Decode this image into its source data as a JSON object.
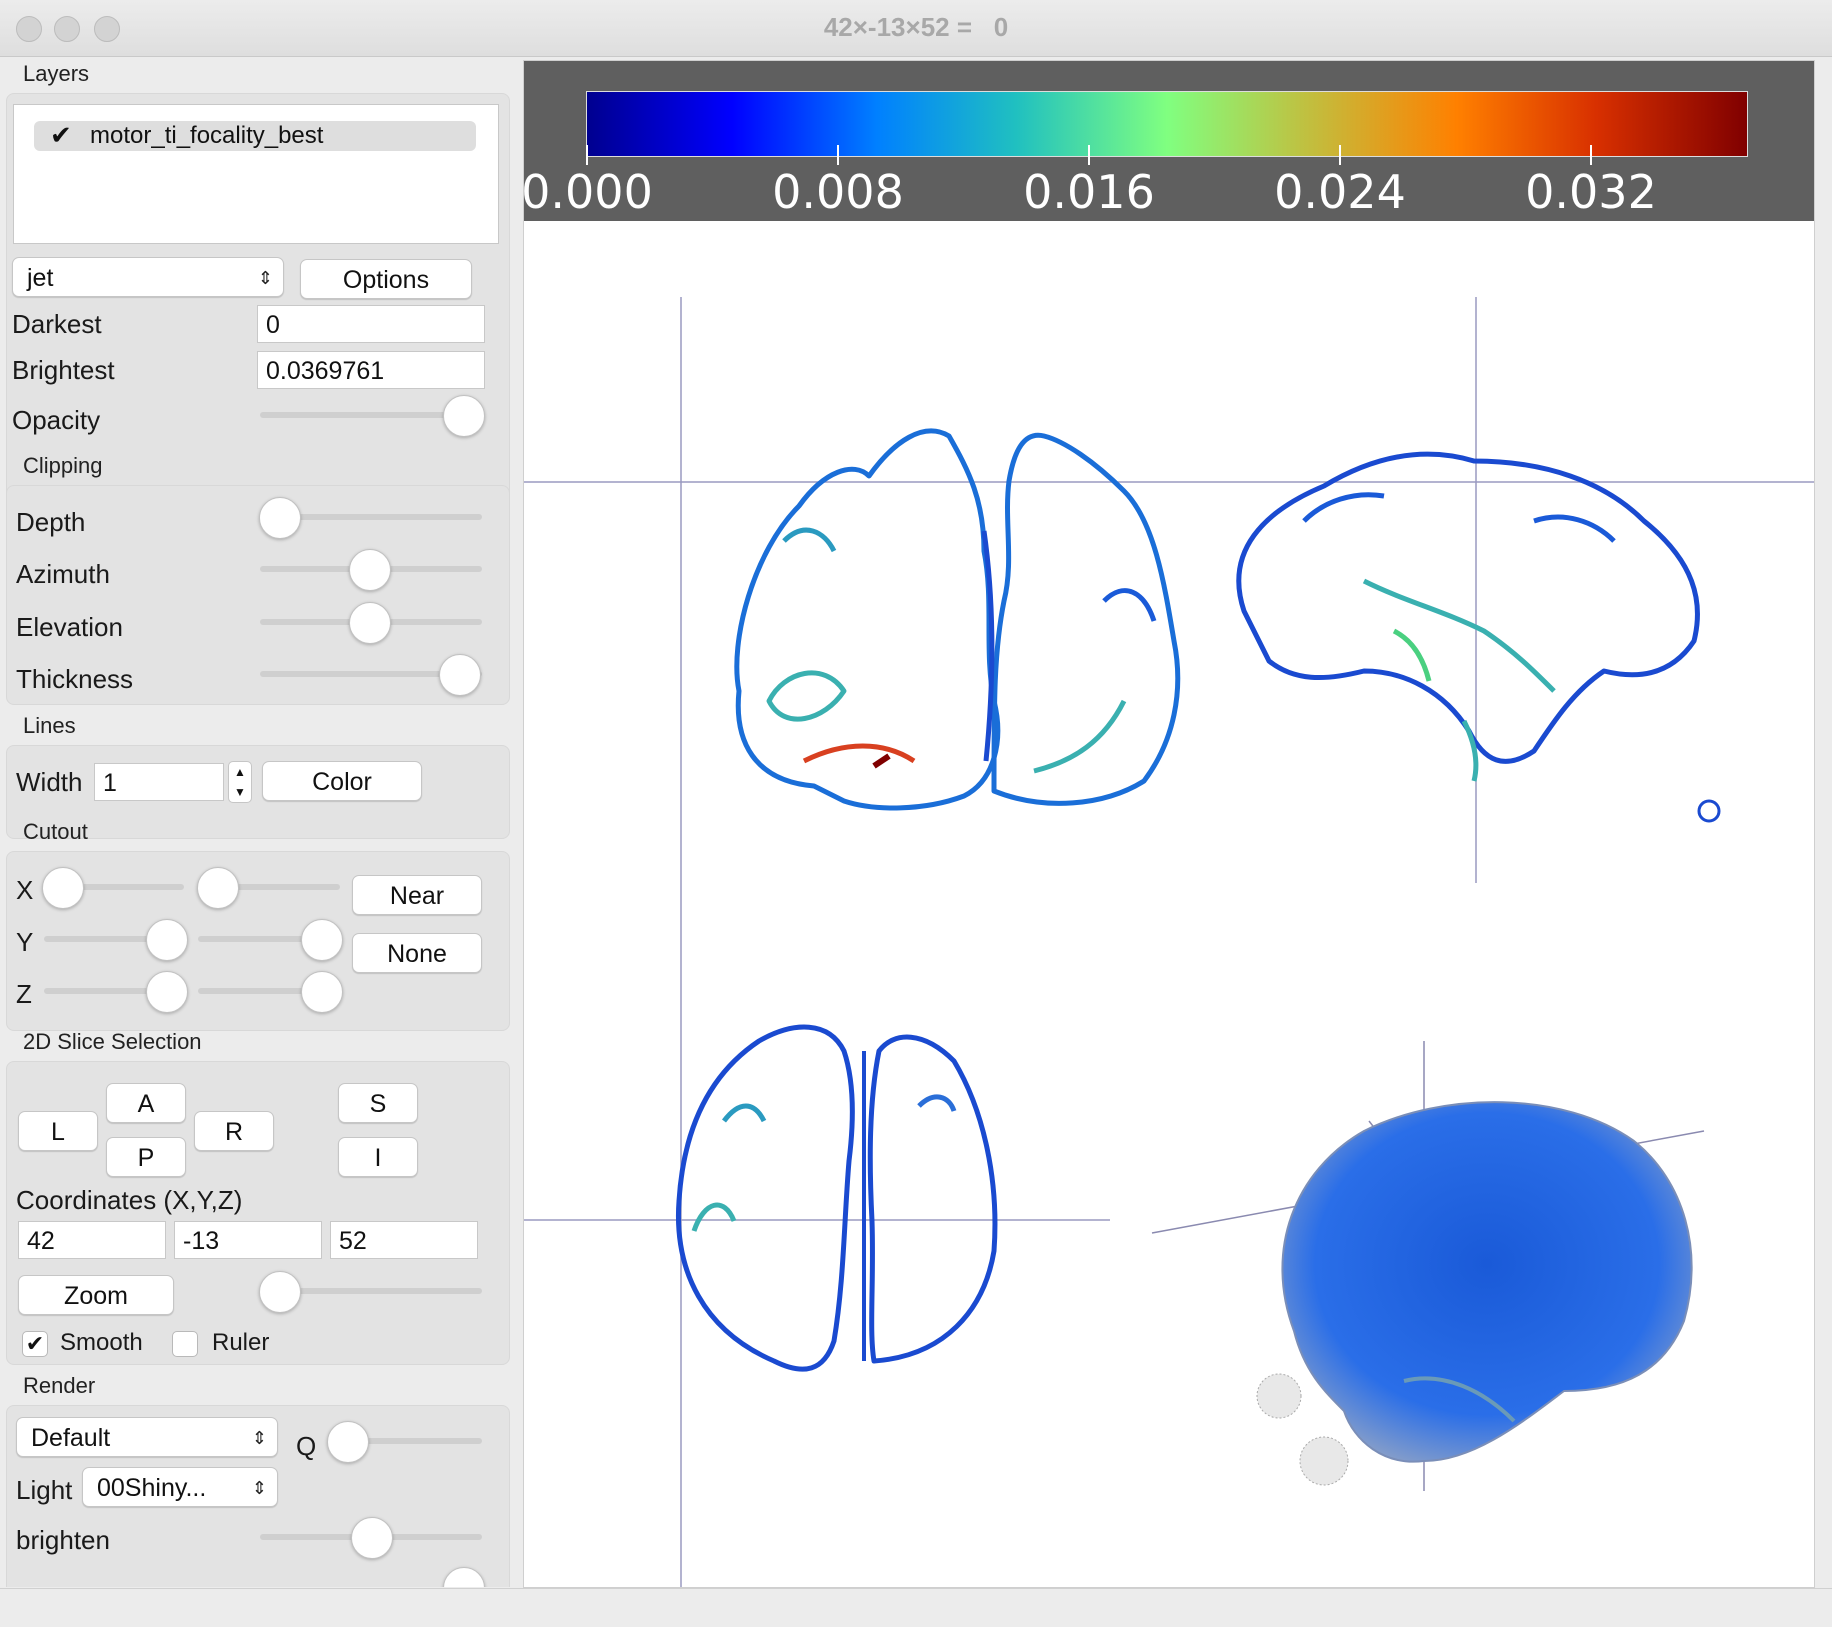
{
  "window": {
    "title": "42×-13×52 =   0"
  },
  "sections": {
    "layers": "Layers",
    "clipping": "Clipping",
    "lines": "Lines",
    "cutout": "Cutout",
    "slice": "2D Slice Selection",
    "render": "Render"
  },
  "layers": {
    "items": [
      {
        "name": "motor_ti_focality_best",
        "checked": true
      }
    ]
  },
  "colormap": {
    "selected": "jet",
    "options_label": "Options"
  },
  "darkest": {
    "label": "Darkest",
    "value": "0"
  },
  "brightest": {
    "label": "Brightest",
    "value": "0.0369761"
  },
  "opacity": {
    "label": "Opacity",
    "level": 1.0
  },
  "clipping": {
    "depth": {
      "label": "Depth",
      "level": 0.0
    },
    "azimuth": {
      "label": "Azimuth",
      "level": 0.5
    },
    "elevation": {
      "label": "Elevation",
      "level": 0.5
    },
    "thickness": {
      "label": "Thickness",
      "level": 1.0
    }
  },
  "lines": {
    "width_label": "Width",
    "width_value": "1",
    "color_label": "Color"
  },
  "cutout": {
    "x_label": "X",
    "y_label": "Y",
    "z_label": "Z",
    "near_label": "Near",
    "none_label": "None",
    "x_levels": [
      0.0,
      0.0
    ],
    "y_levels": [
      0.85,
      0.85
    ],
    "z_levels": [
      0.85,
      0.85
    ]
  },
  "slice": {
    "buttons": {
      "L": "L",
      "A": "A",
      "R": "R",
      "P": "P",
      "S": "S",
      "I": "I"
    },
    "coords_label": "Coordinates (X,Y,Z)",
    "x": "42",
    "y": "-13",
    "z": "52",
    "zoom_label": "Zoom",
    "zoom_level": 0.0,
    "smooth_label": "Smooth",
    "smooth_checked": true,
    "ruler_label": "Ruler",
    "ruler_checked": false
  },
  "render": {
    "mode": "Default",
    "q_label": "Q",
    "q_level": 0.0,
    "light_label": "Light",
    "light_value": "00Shiny...",
    "brighten_label": "brighten",
    "brighten_level": 0.5
  },
  "colorbar": {
    "ticks": [
      "0.000",
      "0.008",
      "0.016",
      "0.024",
      "0.032"
    ],
    "min": 0,
    "max": 0.0369761,
    "colormap": "jet"
  },
  "views": [
    "coronal",
    "sagittal",
    "axial",
    "3d-render"
  ]
}
